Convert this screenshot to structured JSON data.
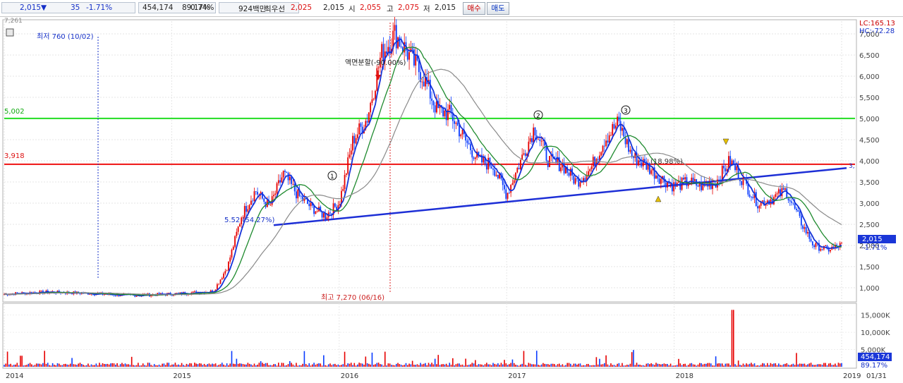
{
  "header": {
    "price": "2,015",
    "down_arrow": "▼",
    "change": "35",
    "change_pct": "-1.71%",
    "volume": "454,174",
    "vol_ratio": "89.17%",
    "turnover": "0.74%",
    "amount": "924백만",
    "best_bid_label": "최우선",
    "best_bid": "2,025",
    "best_ask": "2,015",
    "open_label": "시",
    "open": "2,055",
    "high_label": "고",
    "high": "2,075",
    "low_label": "저",
    "low": "2,015",
    "buy_label": "매수",
    "sell_label": "매도"
  },
  "colors": {
    "up": "#e60000",
    "down": "#0a3cff",
    "ma_short": "#1532d8",
    "ma_mid": "#1e8a2e",
    "ma_long": "#8a8a8a",
    "green_line": "#22dd22",
    "red_line": "#ee1111",
    "trend_line": "#1d2fd6"
  },
  "chart_data": [
    {
      "type": "line",
      "title": "",
      "top_left_value": "7,261",
      "x_ticks": [
        "2014",
        "2015",
        "2016",
        "2017",
        "2018",
        "2019",
        "01/31"
      ],
      "y_ticks": [
        "1,000",
        "1,500",
        "2,000",
        "2,500",
        "3,000",
        "3,500",
        "4,000",
        "4,500",
        "5,000",
        "5,500",
        "6,000",
        "6,500",
        "7,000"
      ],
      "ylim": [
        700,
        7300
      ],
      "series": [
        {
          "type": "candlestick",
          "x": [
            "2014-01",
            "2014-04",
            "2014-07",
            "2014-10",
            "2015-01",
            "2015-04",
            "2015-05",
            "2015-06",
            "2015-07",
            "2015-08",
            "2015-09",
            "2015-10",
            "2015-11",
            "2015-12",
            "2016-01",
            "2016-02",
            "2016-03",
            "2016-04",
            "2016-05",
            "2016-06",
            "2016-07",
            "2016-08",
            "2016-09",
            "2016-10",
            "2016-11",
            "2016-12",
            "2017-01",
            "2017-02",
            "2017-03",
            "2017-04",
            "2017-05",
            "2017-06",
            "2017-07",
            "2017-08",
            "2017-09",
            "2017-10",
            "2017-11",
            "2017-12",
            "2018-01",
            "2018-02",
            "2018-03",
            "2018-04",
            "2018-05",
            "2018-06",
            "2018-07",
            "2018-08",
            "2018-09",
            "2018-10",
            "2018-11",
            "2018-12",
            "2019-01"
          ],
          "close": [
            850,
            900,
            870,
            820,
            850,
            920,
            1500,
            2700,
            3300,
            2900,
            3700,
            3200,
            2900,
            2700,
            3000,
            4500,
            5000,
            6500,
            7000,
            6500,
            6000,
            5200,
            5100,
            4500,
            4000,
            3900,
            3200,
            4000,
            4800,
            4000,
            3900,
            3500,
            3800,
            4500,
            4900,
            4100,
            3900,
            3600,
            3400,
            3500,
            3400,
            3500,
            4000,
            3500,
            3000,
            3100,
            3300,
            2600,
            2000,
            1900,
            2015
          ]
        }
      ],
      "annotations": {
        "low_note": "최저 760 (10/02)",
        "high_note": "최고 7,270 (06/16)",
        "split_note": "액면분할(-90.00%)",
        "trend_left_note": "5.52 (54.27%)",
        "trend_mid_note": "(18.98%)",
        "trend_right_note": "3,",
        "level_green": "5,002",
        "level_red": "3,918",
        "circle_1": "1",
        "circle_2": "2",
        "circle_3": "3",
        "lc": "LC:165.13",
        "hc": "HC:-72.28",
        "last_price": "2,015",
        "last_change": "-1.71%"
      }
    },
    {
      "type": "bar",
      "title": "",
      "y_ticks": [
        "5,000K",
        "10,000K",
        "15,000K"
      ],
      "ylim": [
        0,
        18000
      ],
      "last_volume": "454,174",
      "last_ratio": "89.17%"
    }
  ]
}
